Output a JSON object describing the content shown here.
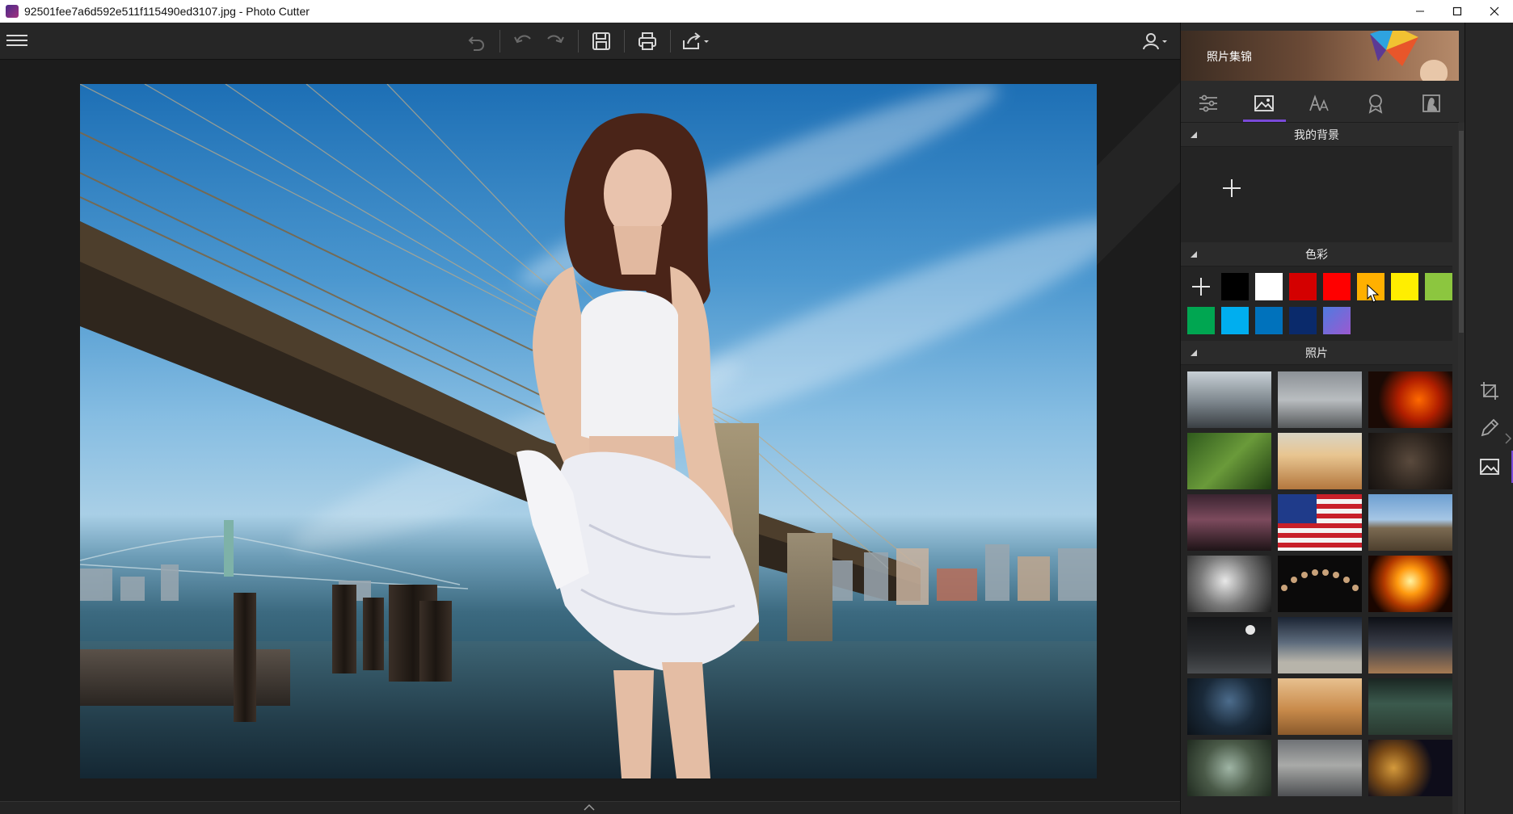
{
  "window": {
    "title": "92501fee7a6d592e511f115490ed3107.jpg - Photo Cutter",
    "app_icon": "photo-cutter-logo",
    "controls": [
      "minimize-icon",
      "maximize-icon",
      "close-icon"
    ]
  },
  "toolbar": {
    "menu_icon": "hamburger-menu-icon",
    "buttons": [
      "undo-all-icon",
      "undo-icon",
      "redo-icon",
      "save-icon",
      "print-icon",
      "share-icon"
    ],
    "user_icon": "user-icon"
  },
  "panel": {
    "banner_text": "照片集锦",
    "tabs": [
      {
        "icon": "adjust-sliders-icon",
        "active": false
      },
      {
        "icon": "background-image-icon",
        "active": true
      },
      {
        "icon": "text-icon",
        "active": false
      },
      {
        "icon": "sticker-award-icon",
        "active": false
      },
      {
        "icon": "portrait-icon",
        "active": false
      }
    ],
    "sections": {
      "my_backgrounds": {
        "title": "我的背景",
        "add_icon": "plus-icon"
      },
      "colors": {
        "title": "色彩",
        "add_icon": "plus-icon",
        "swatches": [
          "#000000",
          "#ffffff",
          "#d40000",
          "#ff0000",
          "#ffb000",
          "#ffee00",
          "#8cc63f",
          "#00a651",
          "#00aeef",
          "#0072bc",
          "#0a2a6b",
          "gradient-purple"
        ]
      },
      "photos": {
        "title": "照片",
        "thumbnails": [
          "misty-mountain-path",
          "snowy-mountain-hand",
          "flaming-guitar",
          "green-jungle",
          "desert-dunes",
          "gorilla-dark",
          "stormy-lightning",
          "american-flag",
          "hollywood-sign",
          "bearded-old-man",
          "moon-phases-arc",
          "fire-explosion",
          "moon-over-hills",
          "planet-horizon",
          "bridge-tunnel-sphere",
          "dark-forest",
          "elephant-savanna",
          "flying-saucer",
          "pterodactyl-trees",
          "rocky-seal",
          "lion-dark"
        ]
      }
    }
  },
  "vertical_tools": [
    "crop-icon",
    "pen-edit-icon",
    "image-background-icon"
  ],
  "accent": "#7a4ad8"
}
